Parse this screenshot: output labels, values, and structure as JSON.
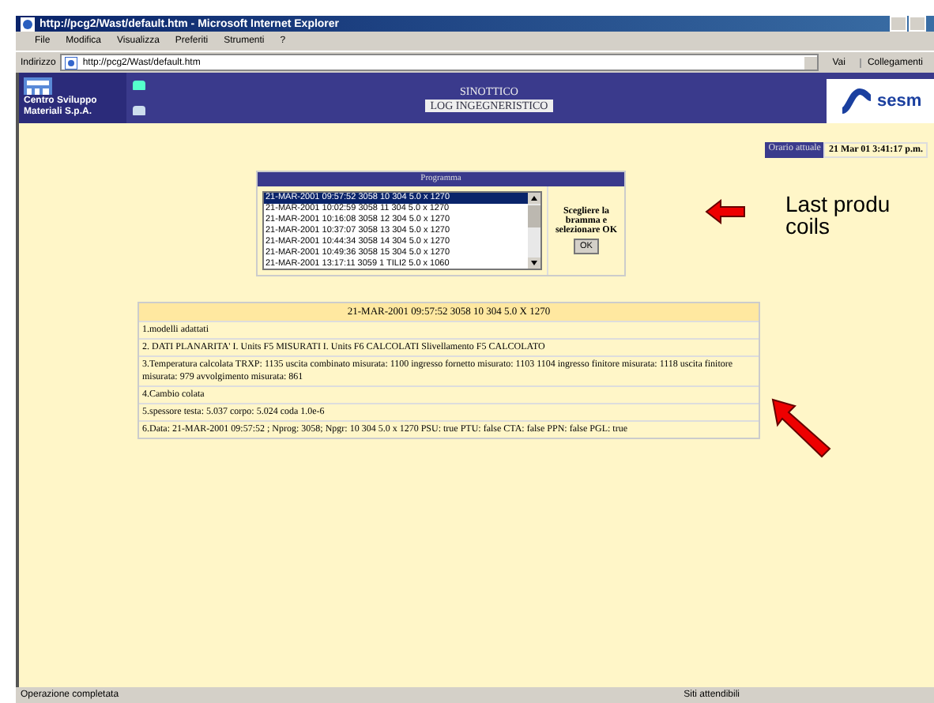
{
  "window": {
    "title": "http://pcg2/Wast/default.htm - Microsoft Internet Explorer"
  },
  "menu": [
    "File",
    "Modifica",
    "Visualizza",
    "Preferiti",
    "Strumenti",
    "?"
  ],
  "address_bar": {
    "label": "Indirizzo",
    "url": "http://pcg2/Wast/default.htm",
    "go": "Vai",
    "links": "Collegamenti"
  },
  "header": {
    "org": "Centro Sviluppo Materiali S.p.A.",
    "title": "SINOTTICO",
    "subtitle": "LOG INGEGNERISTICO",
    "logo": "sesm"
  },
  "clock": {
    "label": "Orario attuale",
    "value": "21 Mar 01 3:41:17 p.m."
  },
  "program": {
    "heading": "Programma",
    "items": [
      {
        "text": "21-MAR-2001 09:57:52 3058 10 304 5.0 x 1270",
        "selected": true
      },
      {
        "text": "21-MAR-2001 10:02:59 3058 11 304 5.0 x 1270",
        "selected": false
      },
      {
        "text": "21-MAR-2001 10:16:08 3058 12 304 5.0 x 1270",
        "selected": false
      },
      {
        "text": "21-MAR-2001 10:37:07 3058 13 304 5.0 x 1270",
        "selected": false
      },
      {
        "text": "21-MAR-2001 10:44:34 3058 14 304 5.0 x 1270",
        "selected": false
      },
      {
        "text": "21-MAR-2001 10:49:36 3058 15 304 5.0 x 1270",
        "selected": false
      },
      {
        "text": "21-MAR-2001 13:17:11 3059 1 TILI2 5.0 x 1060",
        "selected": false
      }
    ],
    "instruction": "Scegliere la bramma e selezionare OK",
    "button": "OK"
  },
  "annotation": {
    "lines": [
      "Last produ",
      "coils"
    ]
  },
  "details": {
    "heading": "21-MAR-2001 09:57:52 3058 10 304 5.0 X 1270",
    "rows": [
      "1.modelli adattati",
      "2. DATI PLANARITA' I. Units F5 MISURATI I. Units F6 CALCOLATI Slivellamento F5 CALCOLATO",
      "3.Temperatura calcolata TRXP: 1135 uscita combinato misurata: 1100 ingresso fornetto misurato: 1103 1104 ingresso finitore misurata: 1118 uscita finitore misurata: 979 avvolgimento misurata: 861",
      "4.Cambio colata",
      "5.spessore testa: 5.037 corpo: 5.024 coda 1.0e-6",
      "6.Data: 21-MAR-2001 09:57:52 ; Nprog: 3058; Npgr: 10 304 5.0 x 1270 PSU: true PTU: false CTA: false PPN: false PGL: true"
    ]
  },
  "status_bar": {
    "left": "Operazione completata",
    "right": "Siti attendibili"
  }
}
